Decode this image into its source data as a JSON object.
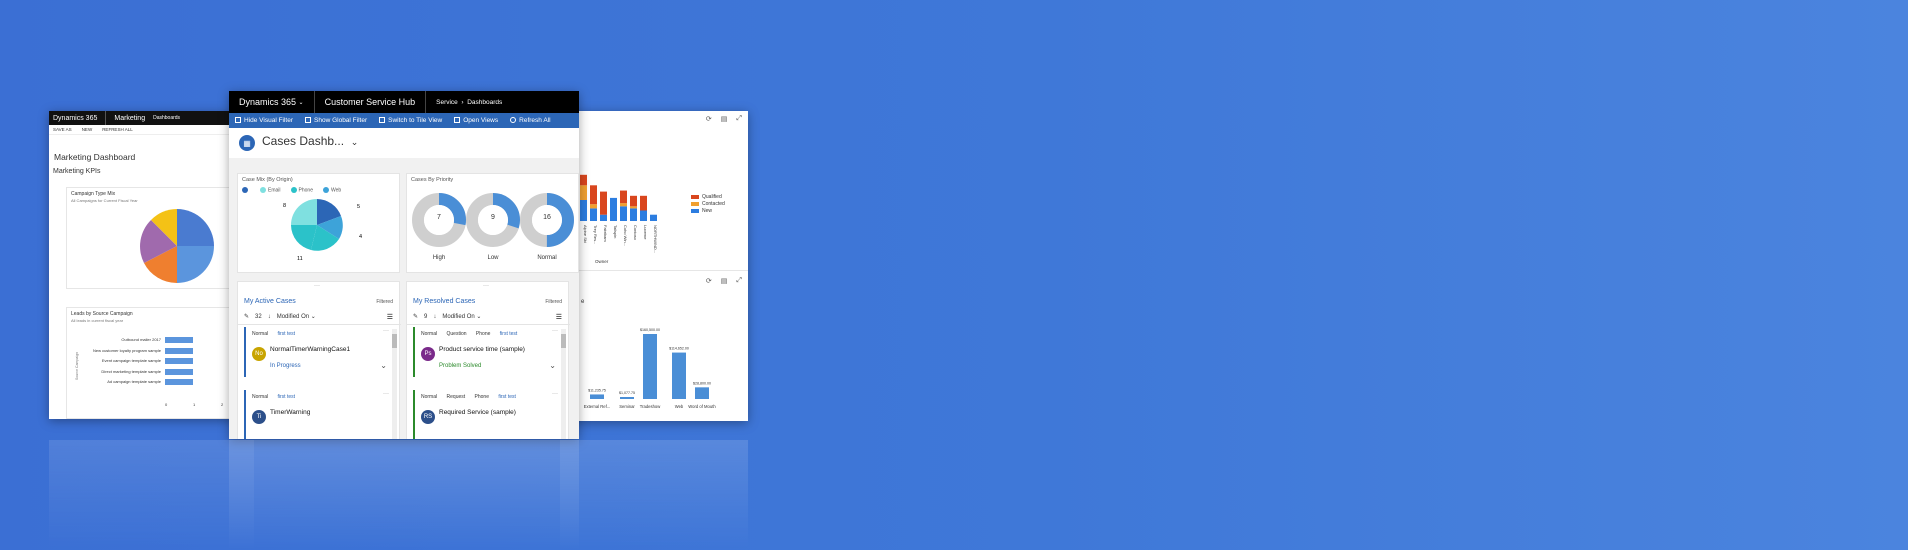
{
  "marketing": {
    "app_title": "Dynamics 365",
    "module": "Marketing",
    "breadcrumb": "Dashboards",
    "cmd": [
      "SAVE AS",
      "NEW",
      "REFRESH ALL"
    ],
    "dashboard_title": "Marketing Dashboard",
    "section": "Marketing KPIs",
    "pie": {
      "title": "Campaign Type Mix",
      "subtitle": "All Campaigns for Current Fiscal Year"
    },
    "leads": {
      "title": "Leads by Source Campaign",
      "subtitle": "All leads in current fiscal year",
      "yaxis": "Source Campaign",
      "categories": [
        "Outbound mailer 2017",
        "New customer loyalty program sample",
        "Event campaign template sample",
        "Direct marketing template sample",
        "Ad campaign template sample"
      ],
      "values": [
        1,
        1,
        1,
        1,
        1
      ],
      "ticks": [
        "0",
        "1",
        "2"
      ]
    }
  },
  "csh": {
    "app_title": "Dynamics 365",
    "app_name": "Customer Service Hub",
    "nav_area": "Service",
    "nav_page": "Dashboards",
    "commands": [
      "Hide Visual Filter",
      "Show Global Filter",
      "Switch to Tile View",
      "Open Views",
      "Refresh All"
    ],
    "dashboard_name": "Cases Dashb...",
    "mix": {
      "title": "Case Mix (By Origin)",
      "legend": [
        "Email",
        "Phone",
        "Web"
      ],
      "legend_colors": [
        "#2c66b6",
        "#7fe0e0",
        "#2bc2c9",
        "#3da3d9"
      ],
      "labels": [
        "8",
        "5",
        "4",
        "11"
      ]
    },
    "priority": {
      "title": "Cases By Priority",
      "items": [
        {
          "label": "High",
          "value": "7",
          "fraction": 0.28
        },
        {
          "label": "Low",
          "value": "9",
          "fraction": 0.3
        },
        {
          "label": "Normal",
          "value": "16",
          "fraction": 0.5
        }
      ]
    },
    "active": {
      "title": "My Active Cases",
      "filter": "Filtered",
      "count": "32",
      "sort": "Modified On",
      "records": [
        {
          "priority": "Normal",
          "type": "",
          "origin": "",
          "tag": "first test",
          "title": "NormalTimerWarningCase1",
          "status": "In Progress",
          "initials": "No",
          "color": "#c8a400",
          "status_color": "#2c66b6"
        },
        {
          "priority": "Normal",
          "type": "",
          "origin": "",
          "tag": "first test",
          "title": "TimerWarning",
          "status": "",
          "initials": "Ti",
          "color": "#2c4f8a",
          "status_color": "#2c66b6"
        }
      ]
    },
    "resolved": {
      "title": "My Resolved Cases",
      "filter": "Filtered",
      "count": "9",
      "sort": "Modified On",
      "records": [
        {
          "priority": "Normal",
          "type": "Question",
          "origin": "Phone",
          "tag": "first test",
          "title": "Product service time (sample)",
          "status": "Problem Solved",
          "initials": "Ps",
          "color": "#7a2a8a",
          "status_color": "#2b8a2b"
        },
        {
          "priority": "Normal",
          "type": "Request",
          "origin": "Phone",
          "tag": "first test",
          "title": "Required Service (sample)",
          "status": "",
          "initials": "RS",
          "color": "#2c4f8a",
          "status_color": "#2b8a2b"
        }
      ]
    }
  },
  "right": {
    "stacked": {
      "categories": [
        "Alpine Ski",
        "Trey Res...",
        "Fabrikam",
        "Tailspin",
        "Coho Win...",
        "Contoso",
        "Lucerne",
        "NORTHWIND..."
      ],
      "legend": [
        "Qualified",
        "Contacted",
        "New"
      ],
      "colors": [
        "#d9461e",
        "#f0a030",
        "#2c7de0"
      ],
      "xlabel": "Owner"
    },
    "bar": {
      "title_fragment": "e",
      "categories": [
        "Em...",
        "External Ref...",
        "Seminar",
        "Tradeshow",
        "Web",
        "Word of Mouth"
      ],
      "values": [
        8000,
        11235,
        1077,
        160500,
        114652,
        28800
      ],
      "labels": [
        "",
        "$11,235.75",
        "$1,077.75",
        "$160,500.00",
        "$114,652.00",
        "$28,800.00"
      ]
    }
  }
}
